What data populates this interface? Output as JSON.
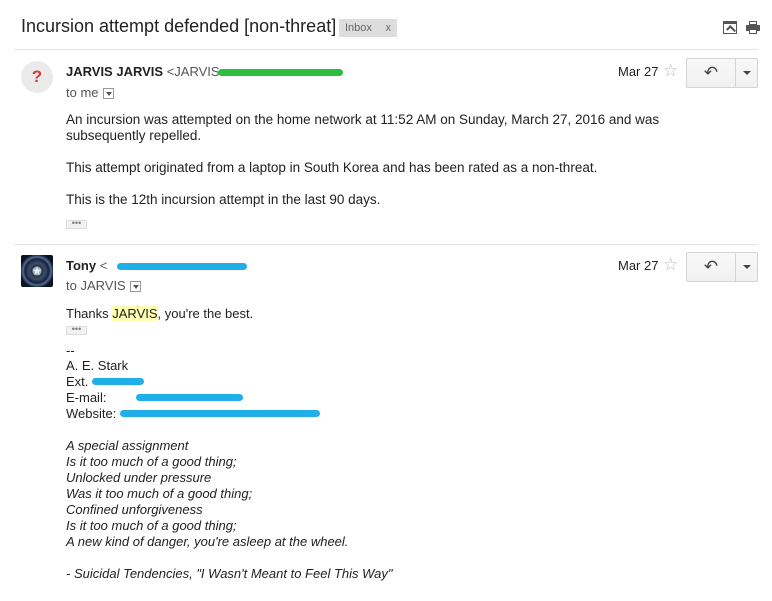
{
  "subject": "Incursion attempt defended [non-threat]",
  "label_chip": {
    "text": "Inbox",
    "close": "x"
  },
  "messages": [
    {
      "sender_name": "JARVIS JARVIS",
      "sender_addr": "<JARVIS",
      "recipient": "to me",
      "date": "Mar 27",
      "paragraphs": [
        "An incursion was attempted on the home network at 11:52 AM on Sunday, March 27, 2016 and was subsequently repelled.",
        "This attempt originated from a laptop in South Korea and has been rated as a non-threat.",
        "This is the 12th incursion attempt in the last 90 days."
      ],
      "trimmed": "•••"
    },
    {
      "sender_name": "Tony",
      "sender_addr": "<",
      "recipient": "to JARVIS",
      "date": "Mar 27",
      "greeting_before": "Thanks ",
      "greeting_highlight": "JARVIS",
      "greeting_after": ", you're the best.",
      "trimmed": "•••",
      "signature": {
        "dash": "--",
        "name": "A. E. Stark",
        "ext_label": "Ext.",
        "email_label": "E-mail:",
        "website_label": "Website:"
      },
      "lyrics": [
        "A special assignment",
        "Is it too much of a good thing;",
        "Unlocked under pressure",
        "Was it too much of a good thing;",
        "Confined unforgiveness",
        "Is it too much of a good thing;",
        "A new kind of danger, you're asleep at the wheel."
      ],
      "attribution": "- Suicidal Tendencies, \"I Wasn't Meant to Feel This Way\""
    }
  ],
  "icons": {
    "new_window": "open-in-new-window-icon",
    "print": "print-icon",
    "reply": "reply-icon",
    "star": "star-icon",
    "more": "dropdown-arrow-icon"
  },
  "colors": {
    "highlight": "#ffffb3",
    "redaction_green": "#2bbf41",
    "redaction_blue": "#1faee8",
    "unknown_avatar_mark": "#d23f31"
  }
}
